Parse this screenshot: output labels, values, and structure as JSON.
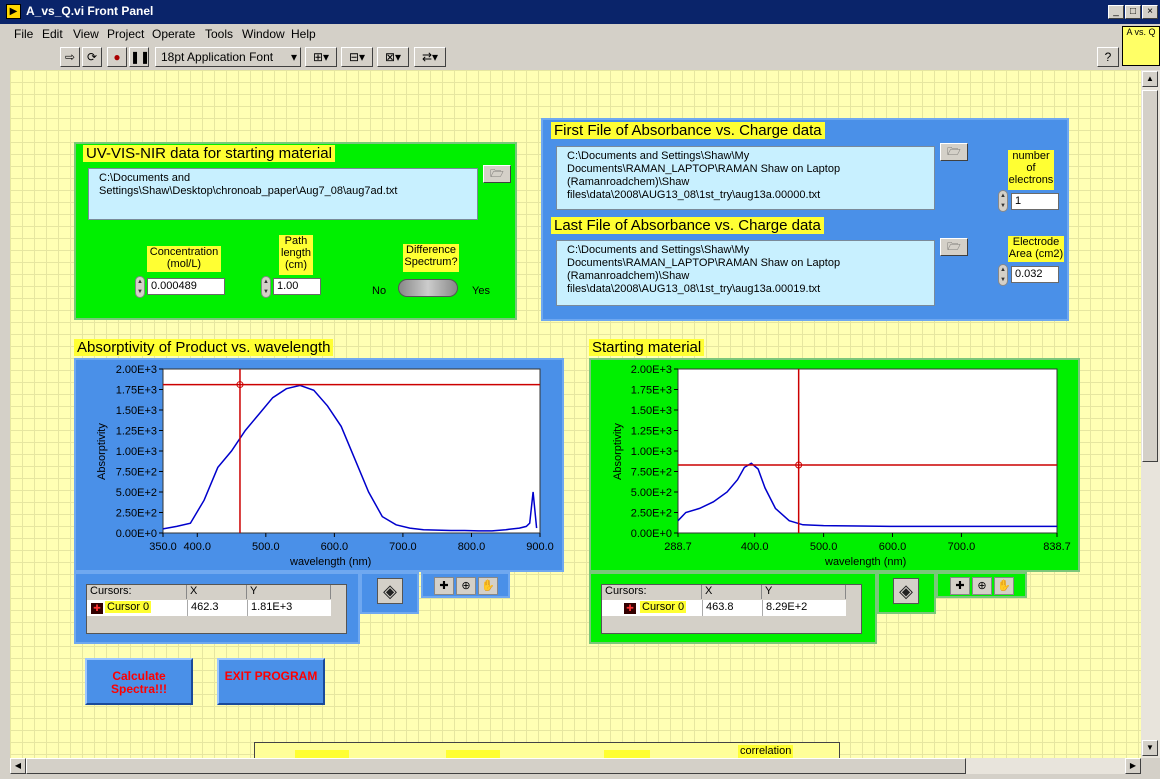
{
  "window": {
    "title": "A_vs_Q.vi Front Panel",
    "icon_text": "A vs. Q"
  },
  "menu": [
    "File",
    "Edit",
    "View",
    "Project",
    "Operate",
    "Tools",
    "Window",
    "Help"
  ],
  "toolbar": {
    "font": "18pt Application Font"
  },
  "uvvis": {
    "title": "UV-VIS-NIR data for starting material",
    "path": "C:\\Documents and Settings\\Shaw\\Desktop\\chronoab_paper\\Aug7_08\\aug7ad.txt",
    "concentration_label": "Concentration (mol/L)",
    "concentration_value": "0.000489",
    "path_length_label": "Path length (cm)",
    "path_length_value": "1.00",
    "difference_label": "Difference Spectrum?",
    "no": "No",
    "yes": "Yes"
  },
  "first_file": {
    "title": "First File of Absorbance vs. Charge data",
    "path": "C:\\Documents and Settings\\Shaw\\My Documents\\RAMAN_LAPTOP\\RAMAN Shaw on Laptop (Ramanroadchem)\\Shaw files\\data\\2008\\AUG13_08\\1st_try\\aug13a.00000.txt",
    "electrons_label": "number of electrons",
    "electrons_value": "1"
  },
  "last_file": {
    "title": "Last File of Absorbance vs. Charge data",
    "path": "C:\\Documents and Settings\\Shaw\\My Documents\\RAMAN_LAPTOP\\RAMAN Shaw on Laptop (Ramanroadchem)\\Shaw files\\data\\2008\\AUG13_08\\1st_try\\aug13a.00019.txt",
    "area_label": "Electrode Area (cm2)",
    "area_value": "0.032"
  },
  "chart_data": [
    {
      "type": "line",
      "title": "Absorptivity of Product vs. wavelength",
      "xlabel": "wavelength (nm)",
      "ylabel": "Absorptivity",
      "xlim": [
        350,
        900
      ],
      "ylim": [
        0,
        2000
      ],
      "x_ticks": [
        "350.0",
        "400.0",
        "500.0",
        "600.0",
        "700.0",
        "800.0",
        "900.0"
      ],
      "y_ticks": [
        "0.00E+0",
        "2.50E+2",
        "5.00E+2",
        "7.50E+2",
        "1.00E+3",
        "1.25E+3",
        "1.50E+3",
        "1.75E+3",
        "2.00E+3"
      ],
      "series": [
        {
          "color": "#0000cc",
          "x": [
            350,
            370,
            390,
            410,
            430,
            450,
            470,
            490,
            510,
            530,
            550,
            570,
            590,
            610,
            630,
            650,
            670,
            690,
            710,
            730,
            750,
            770,
            790,
            810,
            830,
            850,
            870,
            880,
            885,
            890,
            895
          ],
          "y": [
            50,
            80,
            120,
            400,
            800,
            1000,
            1250,
            1450,
            1650,
            1760,
            1800,
            1740,
            1550,
            1300,
            900,
            500,
            200,
            100,
            60,
            40,
            35,
            30,
            30,
            25,
            25,
            40,
            60,
            80,
            120,
            500,
            60
          ]
        }
      ],
      "cursor": {
        "name": "Cursor 0",
        "x": "462.3",
        "y": "1.81E+3",
        "xv": 462.3,
        "yv": 1810
      }
    },
    {
      "type": "line",
      "title": "Starting material",
      "xlabel": "wavelength (nm)",
      "ylabel": "Absorptivity",
      "xlim": [
        288.7,
        838.7
      ],
      "ylim": [
        0,
        2000
      ],
      "x_ticks": [
        "288.7",
        "400.0",
        "500.0",
        "600.0",
        "700.0",
        "838.7"
      ],
      "y_ticks": [
        "0.00E+0",
        "2.50E+2",
        "5.00E+2",
        "7.50E+2",
        "1.00E+3",
        "1.25E+3",
        "1.50E+3",
        "1.75E+3",
        "2.00E+3"
      ],
      "series": [
        {
          "color": "#0000cc",
          "x": [
            288.7,
            300,
            320,
            340,
            360,
            375,
            385,
            395,
            405,
            415,
            430,
            450,
            470,
            500,
            550,
            600,
            700,
            838.7
          ],
          "y": [
            150,
            250,
            300,
            380,
            500,
            650,
            800,
            850,
            780,
            550,
            300,
            150,
            100,
            90,
            85,
            80,
            80,
            80
          ]
        }
      ],
      "cursor": {
        "name": "Cursor 0",
        "x": "463.8",
        "y": "8.29E+2",
        "xv": 463.8,
        "yv": 829
      }
    }
  ],
  "cursor_headers": {
    "name": "Cursors:",
    "x": "X",
    "y": "Y"
  },
  "buttons": {
    "calculate": "Calculate Spectra!!!",
    "exit": "EXIT PROGRAM"
  },
  "bottom": {
    "correlation": "correlation"
  }
}
